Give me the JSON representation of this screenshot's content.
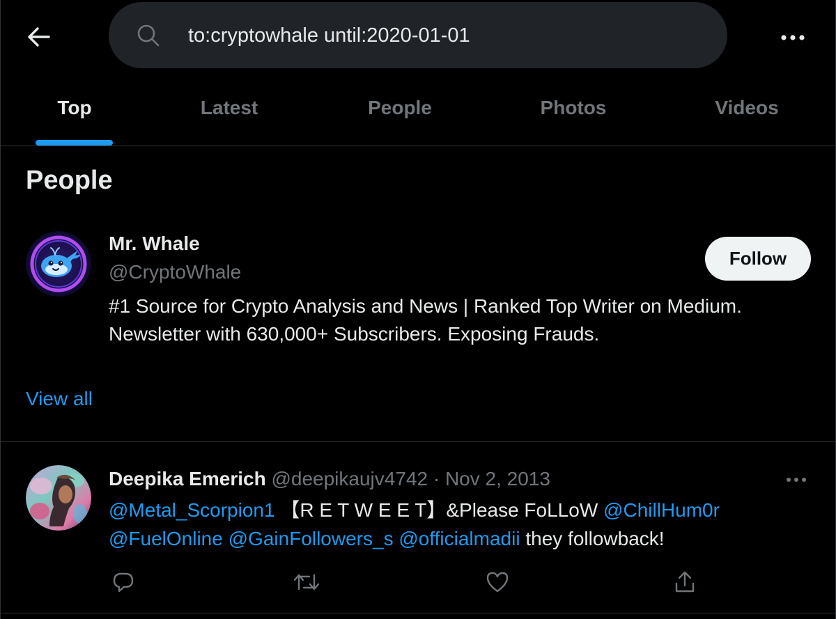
{
  "search": {
    "query": "to:cryptowhale until:2020-01-01"
  },
  "tabs": [
    {
      "label": "Top",
      "active": true
    },
    {
      "label": "Latest",
      "active": false
    },
    {
      "label": "People",
      "active": false
    },
    {
      "label": "Photos",
      "active": false
    },
    {
      "label": "Videos",
      "active": false
    }
  ],
  "people_section": {
    "title": "People",
    "person": {
      "name": "Mr. Whale",
      "handle": "@CryptoWhale",
      "bio_line1": "#1 Source for Crypto Analysis and News | Ranked Top Writer on Medium.",
      "bio_line2": "Newsletter with 630,000+ Subscribers. Exposing Frauds.",
      "follow_label": "Follow"
    },
    "view_all_label": "View all"
  },
  "tweet": {
    "name": "Deepika Emerich",
    "handle": "@deepikaujv4742",
    "separator": "·",
    "date": "Nov 2, 2013",
    "text": {
      "mention1": "@Metal_Scorpion1",
      "body1": " 【R E T W E E T】&Please FoLLoW ",
      "mention2": "@ChillHum0r",
      "mention3": "@FuelOnline",
      "mention4": "@GainFollowers_s",
      "mention5": "@officialmadii",
      "body2": " they followback!"
    },
    "actions": [
      "reply-icon",
      "retweet-icon",
      "like-icon",
      "share-icon"
    ]
  },
  "colors": {
    "background": "#000000",
    "accent": "#1d9bf0",
    "text_primary": "#e7e9ea",
    "text_secondary": "#71767b",
    "search_bg": "#202327",
    "divider": "#2f3336"
  }
}
